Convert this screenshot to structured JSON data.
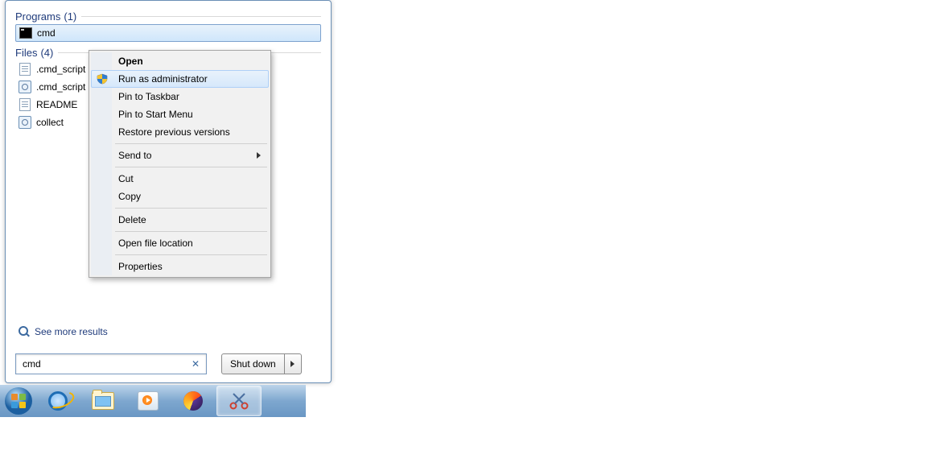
{
  "sections": {
    "programs": {
      "title": "Programs",
      "count": "(1)"
    },
    "files": {
      "title": "Files",
      "count": "(4)"
    }
  },
  "programs": [
    {
      "label": "cmd"
    }
  ],
  "files": [
    {
      "label": ".cmd_script",
      "icon": "txt"
    },
    {
      "label": ".cmd_script",
      "icon": "gear"
    },
    {
      "label": "README",
      "icon": "txt"
    },
    {
      "label": "collect",
      "icon": "gear"
    }
  ],
  "see_more": "See more results",
  "search": {
    "value": "cmd"
  },
  "shutdown": {
    "label": "Shut down"
  },
  "context_menu": {
    "open": "Open",
    "run_admin": "Run as administrator",
    "pin_taskbar": "Pin to Taskbar",
    "pin_start": "Pin to Start Menu",
    "restore": "Restore previous versions",
    "send_to": "Send to",
    "cut": "Cut",
    "copy": "Copy",
    "delete": "Delete",
    "open_loc": "Open file location",
    "properties": "Properties"
  }
}
